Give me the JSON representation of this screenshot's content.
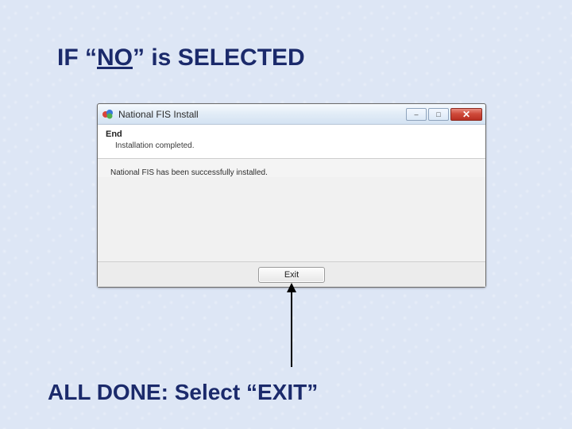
{
  "slide": {
    "title_prefix": "IF “",
    "title_underlined": "NO",
    "title_suffix": "” is SELECTED",
    "caption": "ALL DONE: Select “EXIT”"
  },
  "dialog": {
    "window_title": "National FIS Install",
    "header_title": "End",
    "header_subtitle": "Installation completed.",
    "body_message": "National FIS has been successfully installed.",
    "exit_label": "Exit",
    "controls": {
      "minimize": "–",
      "maximize": "□",
      "close": "✕"
    },
    "icon_name": "app-icon"
  }
}
